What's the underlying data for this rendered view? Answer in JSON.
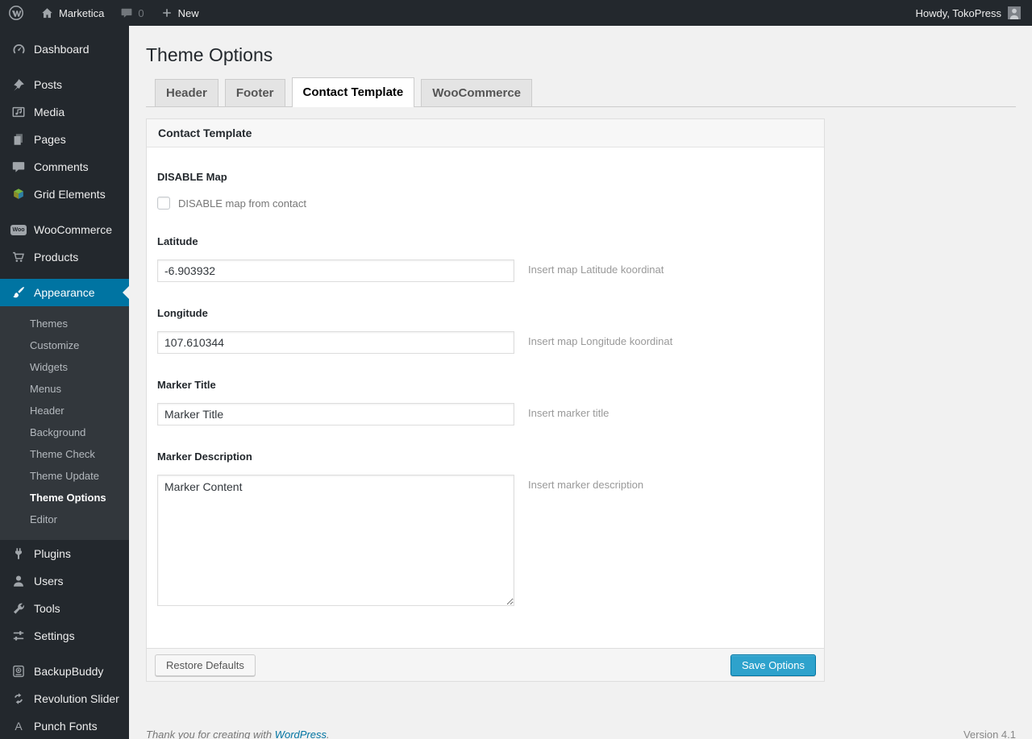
{
  "admin_bar": {
    "site_name": "Marketica",
    "comments_count": "0",
    "new_label": "New",
    "howdy": "Howdy, TokoPress"
  },
  "sidebar": {
    "items": [
      {
        "label": "Dashboard"
      },
      {
        "label": "Posts"
      },
      {
        "label": "Media"
      },
      {
        "label": "Pages"
      },
      {
        "label": "Comments"
      },
      {
        "label": "Grid Elements"
      },
      {
        "label": "WooCommerce"
      },
      {
        "label": "Products"
      },
      {
        "label": "Appearance"
      },
      {
        "label": "Plugins"
      },
      {
        "label": "Users"
      },
      {
        "label": "Tools"
      },
      {
        "label": "Settings"
      },
      {
        "label": "BackupBuddy"
      },
      {
        "label": "Revolution Slider"
      },
      {
        "label": "Punch Fonts"
      }
    ],
    "woo_badge": "Woo",
    "punch_letter": "A",
    "appearance_submenu": [
      {
        "label": "Themes",
        "current": false
      },
      {
        "label": "Customize",
        "current": false
      },
      {
        "label": "Widgets",
        "current": false
      },
      {
        "label": "Menus",
        "current": false
      },
      {
        "label": "Header",
        "current": false
      },
      {
        "label": "Background",
        "current": false
      },
      {
        "label": "Theme Check",
        "current": false
      },
      {
        "label": "Theme Update",
        "current": false
      },
      {
        "label": "Theme Options",
        "current": true
      },
      {
        "label": "Editor",
        "current": false
      }
    ]
  },
  "page": {
    "title": "Theme Options",
    "tabs": [
      {
        "label": "Header",
        "active": false
      },
      {
        "label": "Footer",
        "active": false
      },
      {
        "label": "Contact Template",
        "active": true
      },
      {
        "label": "WooCommerce",
        "active": false
      }
    ],
    "panel": {
      "header": "Contact Template",
      "fields": {
        "disable_map": {
          "label": "DISABLE Map",
          "checkbox_label": "DISABLE map from contact",
          "checked": false
        },
        "latitude": {
          "label": "Latitude",
          "value": "-6.903932",
          "hint": "Insert map Latitude koordinat"
        },
        "longitude": {
          "label": "Longitude",
          "value": "107.610344",
          "hint": "Insert map Longitude koordinat"
        },
        "marker_title": {
          "label": "Marker Title",
          "value": "Marker Title",
          "hint": "Insert marker title"
        },
        "marker_description": {
          "label": "Marker Description",
          "value": "Marker Content",
          "hint": "Insert marker description"
        }
      },
      "buttons": {
        "restore": "Restore Defaults",
        "save": "Save Options"
      }
    }
  },
  "footer": {
    "thanks_prefix": "Thank you for creating with ",
    "link_label": "WordPress",
    "thanks_suffix": ".",
    "version": "Version 4.1"
  },
  "colors": {
    "accent": "#0074a2",
    "primary_button": "#2ea2cc",
    "sidebar_bg": "#23282d",
    "submenu_bg": "#32373c",
    "content_bg": "#f1f1f1"
  }
}
